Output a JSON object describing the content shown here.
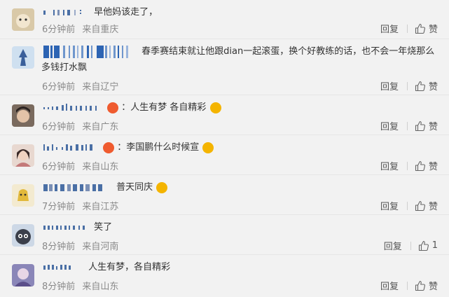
{
  "comments": [
    {
      "text": "早他妈该走了，",
      "time": "6分钟前",
      "location": "来自重庆",
      "reply_label": "回复",
      "like_label": "赞"
    },
    {
      "text": "春季赛结束就让他跟dian一起滚蛋，换个好教练的话，也不会一年烧那么",
      "text2": "多钱打水飘",
      "time": "6分钟前",
      "location": "来自辽宁",
      "reply_label": "回复",
      "like_label": "赞"
    },
    {
      "text": "：人生有梦 各自精彩",
      "time": "6分钟前",
      "location": "来自广东",
      "reply_label": "回复",
      "like_label": "赞"
    },
    {
      "text": "：李国鹏什么时候宣",
      "time": "6分钟前",
      "location": "来自山东",
      "reply_label": "回复",
      "like_label": "赞"
    },
    {
      "text": "普天同庆",
      "time": "7分钟前",
      "location": "来自江苏",
      "reply_label": "回复",
      "like_label": "赞"
    },
    {
      "text": "笑了",
      "time": "8分钟前",
      "location": "来自河南",
      "reply_label": "回复",
      "like_label": "1"
    },
    {
      "text": "人生有梦，各自精彩",
      "time": "8分钟前",
      "location": "来自山东",
      "reply_label": "回复",
      "like_label": "赞"
    }
  ]
}
